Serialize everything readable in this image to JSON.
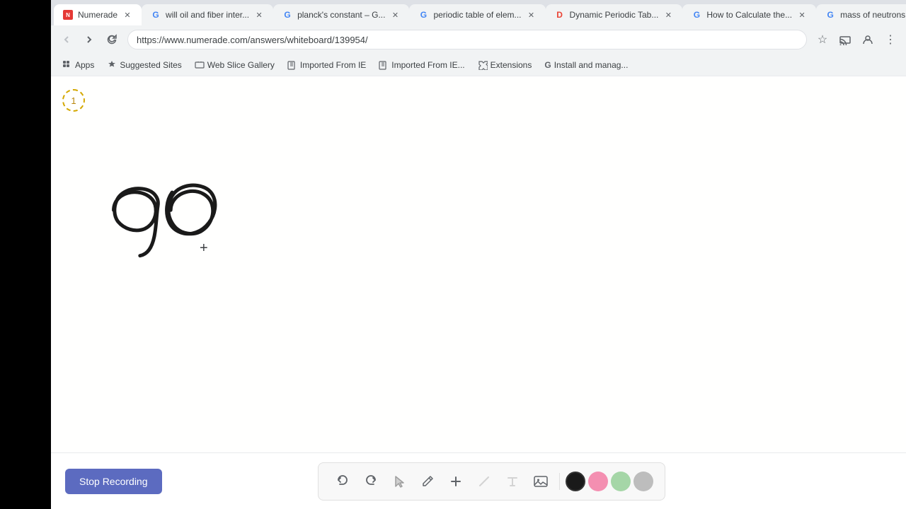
{
  "browser": {
    "address": "https://www.numerade.com/answers/whiteboard/139954/",
    "tabs": [
      {
        "id": "numerade",
        "title": "Numerade",
        "active": true,
        "favicon": "N"
      },
      {
        "id": "will-oil",
        "title": "will oil and fiber inter...",
        "active": false,
        "favicon": "G"
      },
      {
        "id": "plancks",
        "title": "planck's constant – G...",
        "active": false,
        "favicon": "G"
      },
      {
        "id": "periodic-table",
        "title": "periodic table of elem...",
        "active": false,
        "favicon": "G"
      },
      {
        "id": "dynamic-periodic",
        "title": "Dynamic Periodic Tab...",
        "active": false,
        "favicon": "D"
      },
      {
        "id": "how-to-calculate",
        "title": "How to Calculate the...",
        "active": false,
        "favicon": "G"
      },
      {
        "id": "mass-neutrons",
        "title": "mass of neutrons – G...",
        "active": false,
        "favicon": "G"
      }
    ]
  },
  "bookmarks": [
    {
      "label": "Apps"
    },
    {
      "label": "Suggested Sites"
    },
    {
      "label": "Web Slice Gallery"
    },
    {
      "label": "Imported From IE"
    },
    {
      "label": "Imported From IE..."
    },
    {
      "label": "Extensions"
    },
    {
      "label": "Install and manag..."
    }
  ],
  "whiteboard": {
    "page_number": "1",
    "content_text": "90"
  },
  "bottom_toolbar": {
    "stop_recording_label": "Stop Recording",
    "tools": [
      {
        "name": "undo",
        "symbol": "↺"
      },
      {
        "name": "redo",
        "symbol": "↻"
      },
      {
        "name": "select",
        "symbol": "▲"
      },
      {
        "name": "pen",
        "symbol": "✏"
      },
      {
        "name": "add",
        "symbol": "+"
      },
      {
        "name": "eraser",
        "symbol": "/"
      },
      {
        "name": "text",
        "symbol": "T"
      },
      {
        "name": "image",
        "symbol": "▦"
      }
    ],
    "colors": [
      {
        "name": "black",
        "value": "#1a1a1a"
      },
      {
        "name": "pink",
        "value": "#f48fb1"
      },
      {
        "name": "green",
        "value": "#a5d6a7"
      },
      {
        "name": "gray",
        "value": "#bdbdbd"
      }
    ]
  }
}
